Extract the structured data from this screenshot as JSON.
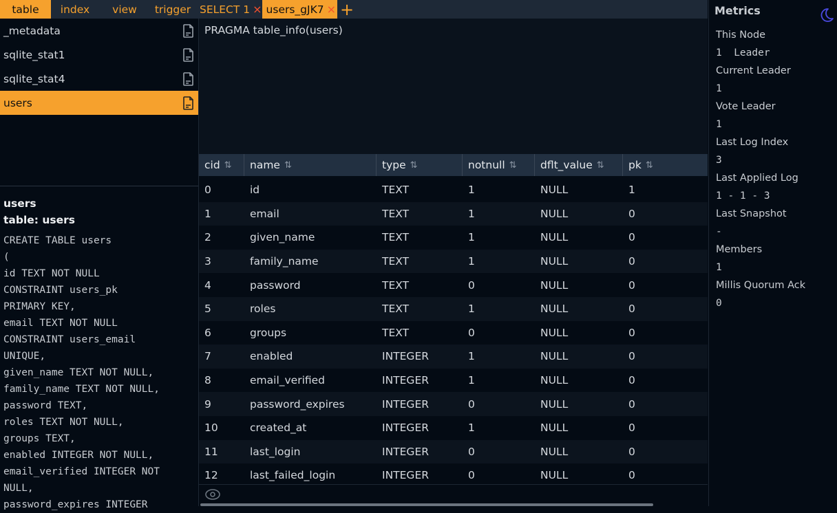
{
  "tabs": [
    {
      "label": "table",
      "active": true
    },
    {
      "label": "index",
      "active": false
    },
    {
      "label": "view",
      "active": false
    },
    {
      "label": "trigger",
      "active": false
    },
    {
      "label": "SELECT 1",
      "active": false,
      "closable": true
    },
    {
      "label": "users_gJK7",
      "active": true,
      "closable": true
    }
  ],
  "close_glyph": "×",
  "add_tab_glyph": "+",
  "tables": [
    {
      "name": "_metadata",
      "icon": "document-icon"
    },
    {
      "name": "sqlite_stat1",
      "icon": "document-icon"
    },
    {
      "name": "sqlite_stat4",
      "icon": "document-icon"
    },
    {
      "name": "users",
      "icon": "document-icon",
      "selected": true
    }
  ],
  "info": {
    "name": "users",
    "subtitle": "table: users",
    "ddl": "CREATE TABLE users\n(\nid TEXT NOT NULL\nCONSTRAINT users_pk\nPRIMARY KEY,\nemail TEXT NOT NULL\nCONSTRAINT users_email\nUNIQUE,\ngiven_name TEXT NOT NULL,\nfamily_name TEXT NOT NULL,\npassword TEXT,\nroles TEXT NOT NULL,\ngroups TEXT,\nenabled INTEGER NOT NULL,\nemail_verified INTEGER NOT\nNULL,\npassword_expires INTEGER"
  },
  "editor": {
    "query": "PRAGMA table_info(users)"
  },
  "grid": {
    "sort_glyph": "⇅",
    "columns": [
      "cid",
      "name",
      "type",
      "notnull",
      "dflt_value",
      "pk"
    ],
    "rows": [
      [
        "0",
        "id",
        "TEXT",
        "1",
        "NULL",
        "1"
      ],
      [
        "1",
        "email",
        "TEXT",
        "1",
        "NULL",
        "0"
      ],
      [
        "2",
        "given_name",
        "TEXT",
        "1",
        "NULL",
        "0"
      ],
      [
        "3",
        "family_name",
        "TEXT",
        "1",
        "NULL",
        "0"
      ],
      [
        "4",
        "password",
        "TEXT",
        "0",
        "NULL",
        "0"
      ],
      [
        "5",
        "roles",
        "TEXT",
        "1",
        "NULL",
        "0"
      ],
      [
        "6",
        "groups",
        "TEXT",
        "0",
        "NULL",
        "0"
      ],
      [
        "7",
        "enabled",
        "INTEGER",
        "1",
        "NULL",
        "0"
      ],
      [
        "8",
        "email_verified",
        "INTEGER",
        "1",
        "NULL",
        "0"
      ],
      [
        "9",
        "password_expires",
        "INTEGER",
        "0",
        "NULL",
        "0"
      ],
      [
        "10",
        "created_at",
        "INTEGER",
        "1",
        "NULL",
        "0"
      ],
      [
        "11",
        "last_login",
        "INTEGER",
        "0",
        "NULL",
        "0"
      ],
      [
        "12",
        "last_failed_login",
        "INTEGER",
        "0",
        "NULL",
        "0"
      ]
    ]
  },
  "metrics": {
    "title": "Metrics",
    "items": [
      {
        "label": "This Node",
        "value": "1  Leader"
      },
      {
        "label": "Current Leader",
        "value": "1"
      },
      {
        "label": "Vote Leader",
        "value": "1"
      },
      {
        "label": "Last Log Index",
        "value": "3"
      },
      {
        "label": "Last Applied Log",
        "value": "1 - 1 - 3"
      },
      {
        "label": "Last Snapshot",
        "value": "-"
      },
      {
        "label": "Members",
        "value": "1"
      },
      {
        "label": "Millis Quorum Ack",
        "value": "0"
      }
    ]
  },
  "colors": {
    "accent": "#f6a12d",
    "close": "#f6502d",
    "moon": "#4a4ae0"
  }
}
